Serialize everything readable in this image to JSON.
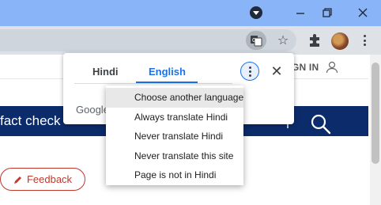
{
  "browser": {
    "colors": {
      "titlebar": "#8ab4f8",
      "toolbar": "#dee1e6"
    },
    "toolbar": {
      "translate_icon": "translate-icon",
      "star_icon": "star-icon",
      "extensions_icon": "puzzle-icon",
      "menu_icon": "kebab-icon"
    }
  },
  "page": {
    "signin_label": "GN IN",
    "nav_text": "fact check",
    "feedback_label": "Feedback",
    "colors": {
      "nav_band": "#0c2b6b",
      "feedback": "#c0392b"
    }
  },
  "translate_bubble": {
    "tabs": [
      {
        "label": "Hindi",
        "selected": false
      },
      {
        "label": "English",
        "selected": true
      }
    ],
    "footer": "Google",
    "accent": "#1a73e8",
    "menu": {
      "items": [
        {
          "label": "Choose another language",
          "highlighted": true
        },
        {
          "label": "Always translate Hindi",
          "highlighted": false
        },
        {
          "label": "Never translate Hindi",
          "highlighted": false
        },
        {
          "label": "Never translate this site",
          "highlighted": false
        },
        {
          "label": "Page is not in Hindi",
          "highlighted": false
        }
      ]
    }
  }
}
